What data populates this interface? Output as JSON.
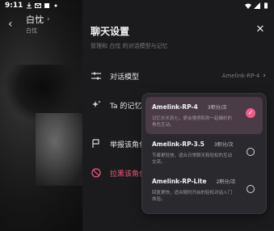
{
  "status_bar": {
    "time": "9:11"
  },
  "chat": {
    "character_name": "白忱",
    "character_sub": "白忱"
  },
  "panel": {
    "title": "聊天设置",
    "subtitle": "管理和 白忱 的对话模型与记忆",
    "rows": [
      {
        "icon": "sliders-icon",
        "label": "对话模型",
        "value": "Amelink-RP-4"
      },
      {
        "icon": "sparkle-icon",
        "label": "Ta 的记忆"
      },
      {
        "icon": "flag-icon",
        "label": "举报该角色"
      },
      {
        "icon": "block-icon",
        "label": "拉黑该角色"
      }
    ]
  },
  "dropdown": {
    "options": [
      {
        "name": "Amelink-RP-4",
        "cost": "3积分/次",
        "desc": "记忆长长到七，更会懂得和你一起编织的角色互动。",
        "selected": true
      },
      {
        "name": "Amelink-RP-3.5",
        "cost": "3积分/次",
        "desc": "节奏更轻快，适合日常聊天和轻松的互动交流。",
        "selected": false
      },
      {
        "name": "Amelink-RP-Lite",
        "cost": "2积分/次",
        "desc": "回复更快，适合随时开启的轻松对话入门体验。",
        "selected": false
      }
    ]
  },
  "colors": {
    "accent": "#f05c8a",
    "danger": "#ef5a7a",
    "panel_bg": "#1b1b1d",
    "dropdown_bg": "#2a2a2e"
  }
}
